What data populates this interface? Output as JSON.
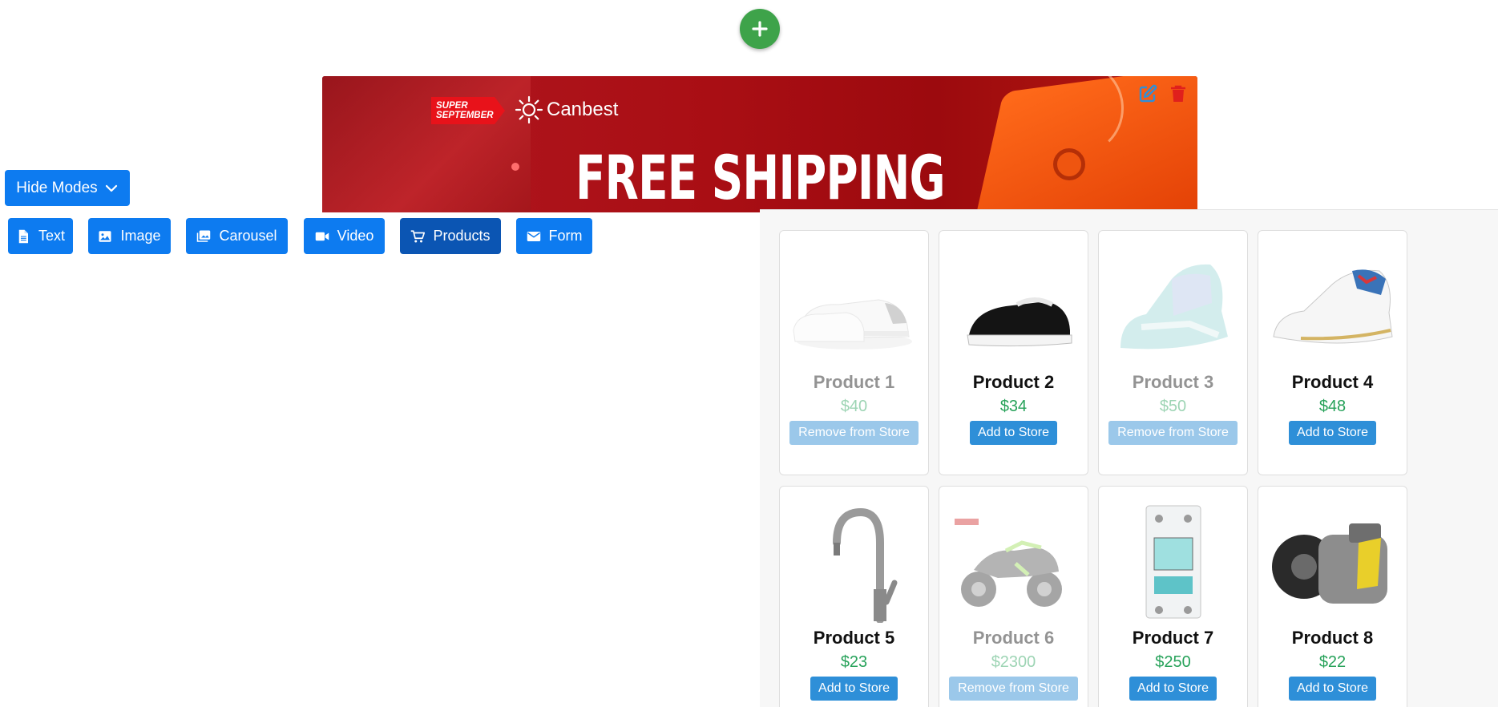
{
  "banner": {
    "badge_line1": "SUPER",
    "badge_line2": "SEPTEMBER",
    "brand": "Canbest",
    "headline": "FREE SHIPPING"
  },
  "toolbar": {
    "hide_modes_label": "Hide Modes",
    "modes": [
      {
        "label": "Text",
        "icon": "file-icon"
      },
      {
        "label": "Image",
        "icon": "image-icon"
      },
      {
        "label": "Carousel",
        "icon": "images-icon"
      },
      {
        "label": "Video",
        "icon": "video-icon"
      },
      {
        "label": "Products",
        "icon": "cart-icon",
        "active": true
      },
      {
        "label": "Form",
        "icon": "envelope-icon"
      }
    ]
  },
  "products": [
    {
      "name": "Product 1",
      "price": "$40",
      "action": "Remove from Store",
      "in_store": true
    },
    {
      "name": "Product 2",
      "price": "$34",
      "action": "Add to Store",
      "in_store": false
    },
    {
      "name": "Product 3",
      "price": "$50",
      "action": "Remove from Store",
      "in_store": true
    },
    {
      "name": "Product 4",
      "price": "$48",
      "action": "Add to Store",
      "in_store": false
    },
    {
      "name": "Product 5",
      "price": "$23",
      "action": "Add to Store",
      "in_store": false
    },
    {
      "name": "Product 6",
      "price": "$2300",
      "action": "Remove from Store",
      "in_store": true
    },
    {
      "name": "Product 7",
      "price": "$250",
      "action": "Add to Store",
      "in_store": false
    },
    {
      "name": "Product 8",
      "price": "$22",
      "action": "Add to Store",
      "in_store": false
    }
  ],
  "colors": {
    "primary": "#0d7bf0",
    "primary_active": "#0b55b3",
    "add_green": "#3ea34a",
    "price_green": "#27a25a",
    "store_button": "#2e8fd8",
    "remove_button": "#9bc8ea",
    "banner_red": "#a90e14",
    "edit_blue": "#2e8fd8",
    "delete_red": "#e0201c"
  }
}
